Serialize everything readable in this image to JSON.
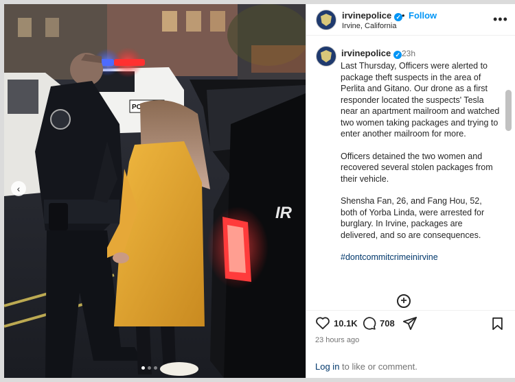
{
  "account": {
    "username": "irvinepolice",
    "separator": "•",
    "follow_label": "Follow",
    "location": "Irvine, California",
    "more_label": "•••"
  },
  "caption": {
    "username": "irvinepolice",
    "time_ago": "23h",
    "paragraphs": [
      "Last Thursday, Officers were alerted to package theft suspects in the area of Perlita and Gitano. Our drone as a first responder located the suspects' Tesla near an apartment mailroom and watched two women taking packages and trying to enter another mailroom for more.",
      "Officers detained the two women and recovered several stolen packages from their vehicle.",
      "Shensha Fan, 26, and Fang Hou, 52, both of Yorba Linda, were arrested for burglary. In Irvine, packages are delivered, and so are consequences."
    ],
    "hashtag": "#dontcommitcrimeinirvine",
    "add_comment_icon": "plus-circle-icon"
  },
  "stats": {
    "likes": "10.1K",
    "comments": "708"
  },
  "posted": "23 hours ago",
  "login": {
    "link": "Log in",
    "text": " to like or comment."
  },
  "media": {
    "prev_icon": "‹",
    "decal_text": "POLICE",
    "suv_text": "IR",
    "carousel": {
      "total": 3,
      "active": 1
    }
  },
  "colors": {
    "accent": "#0095f6",
    "link": "#00376b",
    "coat": "#e0a631",
    "uniform": "#14161c",
    "taillight": "#ff3b3b"
  }
}
